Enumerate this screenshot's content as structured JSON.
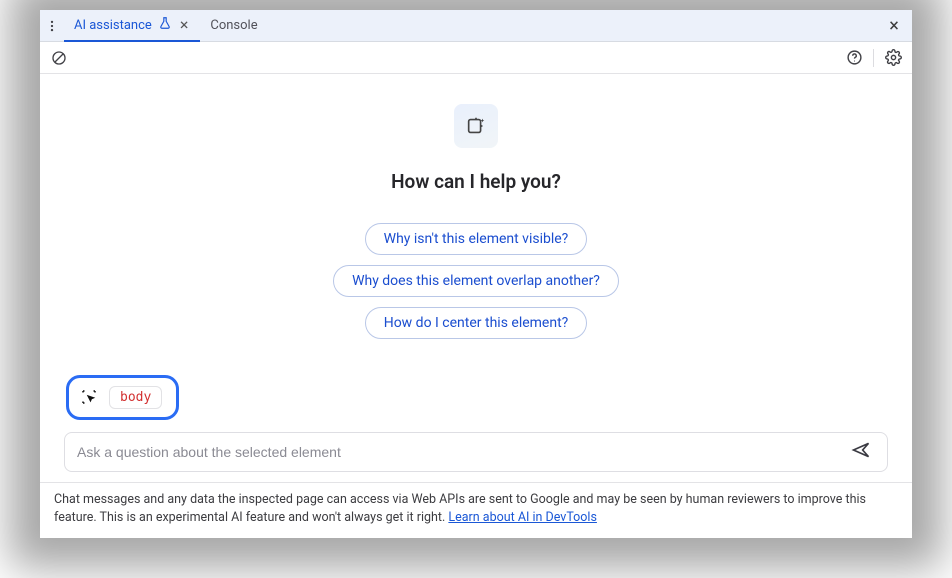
{
  "tabs": {
    "ai_assistance": "AI assistance",
    "console": "Console"
  },
  "heading": "How can I help you?",
  "suggestions": [
    "Why isn't this element visible?",
    "Why does this element overlap another?",
    "How do I center this element?"
  ],
  "context": {
    "selected_element_tag": "body"
  },
  "input": {
    "placeholder": "Ask a question about the selected element"
  },
  "footer": {
    "text": "Chat messages and any data the inspected page can access via Web APIs are sent to Google and may be seen by human reviewers to improve this feature. This is an experimental AI feature and won't always get it right. ",
    "link_text": "Learn about AI in DevTools"
  }
}
